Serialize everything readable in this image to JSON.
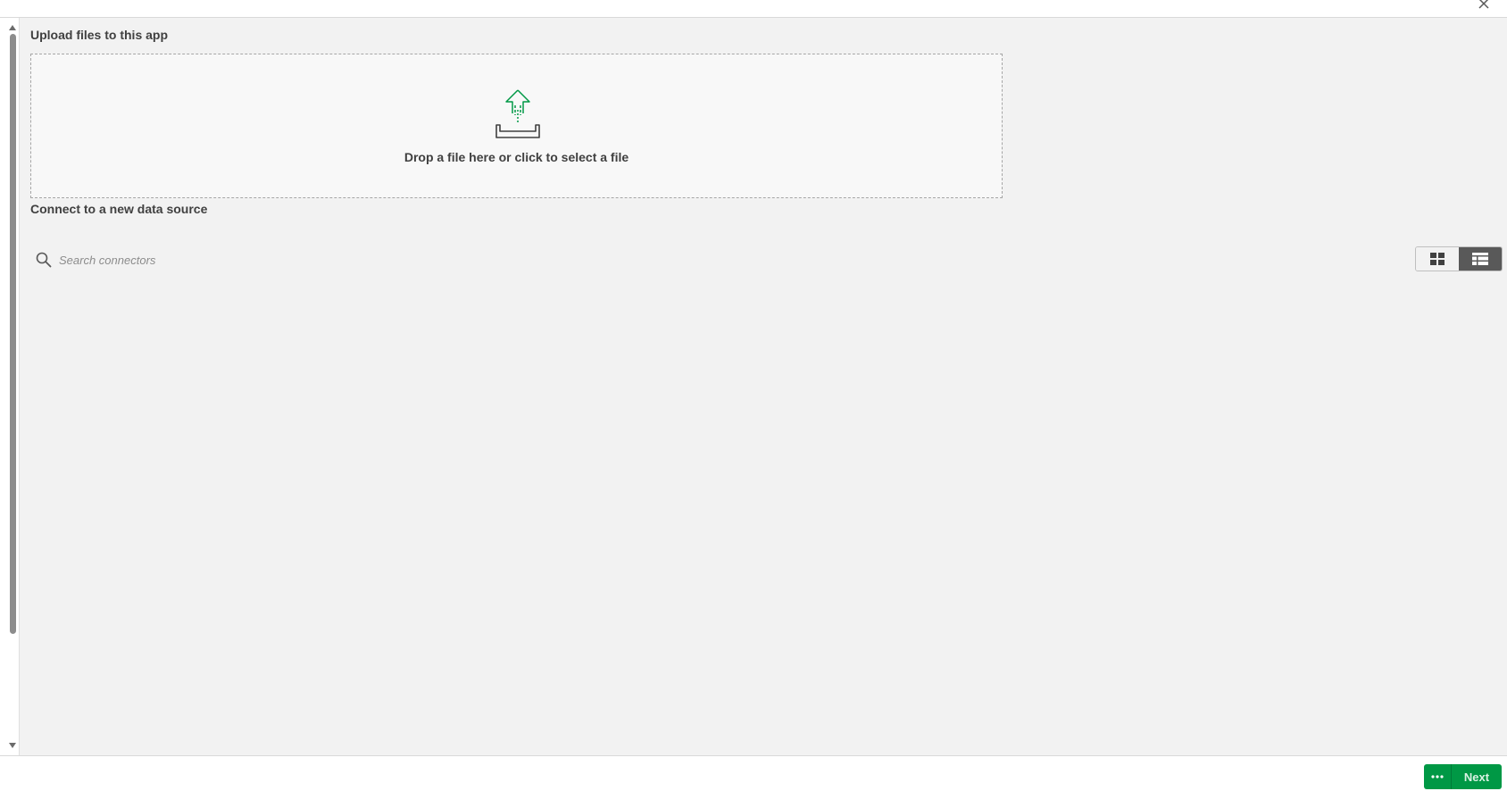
{
  "upload": {
    "title": "Upload files to this app",
    "dropzone_text": "Drop a file here or click to select a file"
  },
  "connect": {
    "title": "Connect to a new data source",
    "search_placeholder": "Search connectors"
  },
  "view_toggle": {
    "active": "list"
  },
  "footer": {
    "next_label": "Next"
  },
  "colors": {
    "accent": "#009845",
    "panel_bg": "#f2f2f2",
    "toggle_active": "#595959"
  },
  "icons": {
    "upload": "upload-icon",
    "search": "search-icon",
    "grid": "grid-view-icon",
    "list": "list-view-icon",
    "close": "close-icon",
    "more": "more-dots-icon"
  }
}
